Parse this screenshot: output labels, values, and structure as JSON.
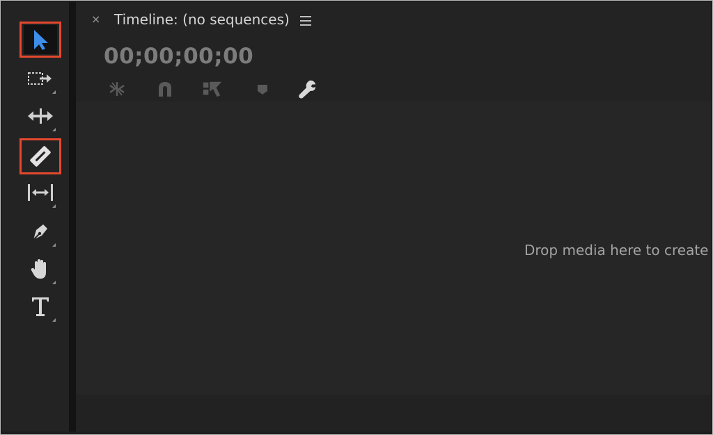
{
  "timeline": {
    "close_label": "×",
    "title": "Timeline: (no sequences)",
    "timecode": "00;00;00;00",
    "drop_hint": "Drop media here to create s"
  },
  "tools": [
    {
      "name": "selection-tool",
      "icon": "arrow-cursor-icon",
      "highlighted": true
    },
    {
      "name": "track-select-forward-tool",
      "icon": "track-select-forward-icon",
      "highlighted": false
    },
    {
      "name": "ripple-edit-tool",
      "icon": "ripple-edit-icon",
      "highlighted": false
    },
    {
      "name": "razor-tool",
      "icon": "razor-blade-icon",
      "highlighted": true
    },
    {
      "name": "slip-tool",
      "icon": "slip-icon",
      "highlighted": false
    },
    {
      "name": "pen-tool",
      "icon": "pen-icon",
      "highlighted": false
    },
    {
      "name": "hand-tool",
      "icon": "hand-icon",
      "highlighted": false
    },
    {
      "name": "type-tool",
      "icon": "type-icon",
      "highlighted": false
    }
  ],
  "timeline_toolbar": [
    {
      "name": "insert-nest-toggle",
      "icon": "nest-icon"
    },
    {
      "name": "snap-toggle",
      "icon": "magnet-icon"
    },
    {
      "name": "linked-selection-toggle",
      "icon": "linked-selection-icon"
    },
    {
      "name": "add-marker-button",
      "icon": "marker-icon"
    },
    {
      "name": "timeline-settings-button",
      "icon": "wrench-icon"
    }
  ],
  "colors": {
    "highlight": "#e5482e",
    "selection_blue": "#3d8ee8",
    "panel": "#232323"
  }
}
